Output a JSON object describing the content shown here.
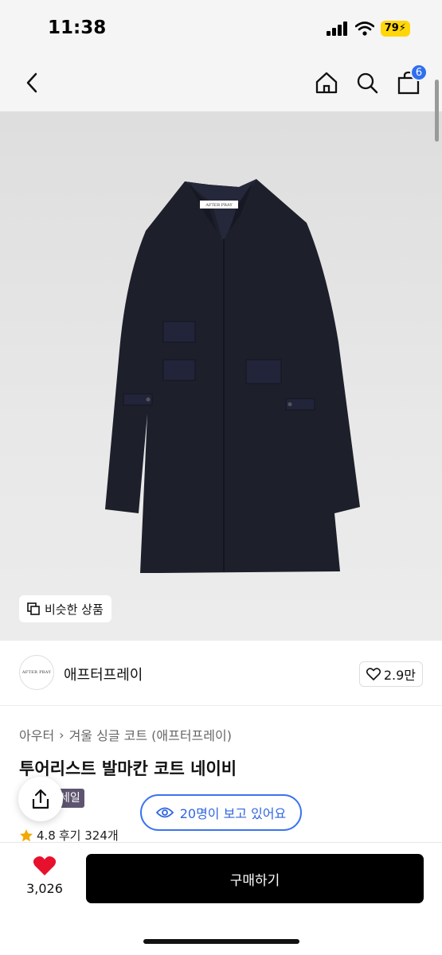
{
  "status": {
    "time": "11:38",
    "battery": "79"
  },
  "nav": {
    "cart_count": "6"
  },
  "hero": {
    "similar_label": "비슷한 상품",
    "coat_label_text": "AFTER PRAY"
  },
  "brand": {
    "logo_text": "AFTER PRAY",
    "name": "애프터프레이",
    "likes": "2.9만"
  },
  "product": {
    "breadcrumb": [
      "아우터",
      "겨울 싱글 코트 (애프터프레이)"
    ],
    "title": "투어리스트 발마칸 코트 네이비",
    "sale_badge": "세일",
    "viewers": "20명이 보고 있어요",
    "rating": "4.8",
    "reviews": "후기 324개"
  },
  "bottom": {
    "heart_count": "3,026",
    "buy_label": "구매하기"
  },
  "colors": {
    "accent": "#3b74ef",
    "heart": "#e8112d",
    "coat": "#1d1f2a"
  }
}
